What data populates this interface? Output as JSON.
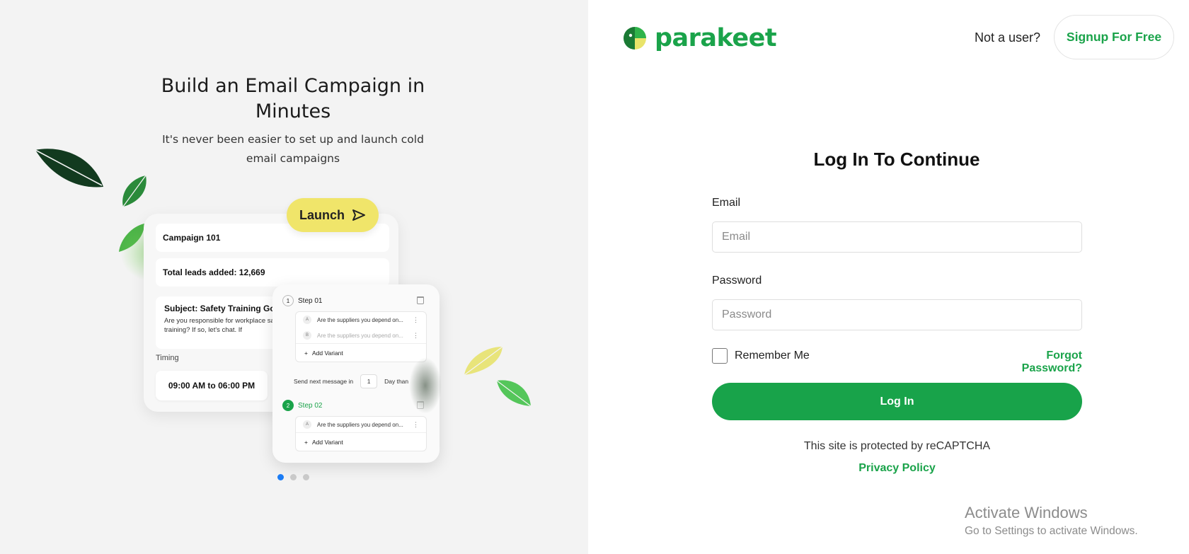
{
  "hero": {
    "title": "Build an Email Campaign in Minutes",
    "subtitle": "It's never been easier to set up and launch cold email campaigns",
    "launch_label": "Launch",
    "campaign_name": "Campaign 101",
    "leads": "Total leads added: 12,669",
    "subject": "Subject: Safety Training Go",
    "body": "Are you responsible for workplace safety training? If so, let's chat. If",
    "timing_label": "Timing",
    "timing_value": "09:00 AM to 06:00 PM",
    "step1_num": "1",
    "step1_label": "Step 01",
    "step2_num": "2",
    "step2_label": "Step 02",
    "variant_a_letter": "A",
    "variant_a_text": "Are the suppliers you depend on...",
    "variant_b_letter": "B",
    "variant_b_text": "Are the suppliers you depend on...",
    "variant_2a_letter": "A",
    "variant_2a_text": "Are the suppliers you depend on...",
    "add_variant": "Add Variant",
    "send_next": "Send next message in",
    "send_num": "1",
    "send_unit": "Day than",
    "slide_count": 3,
    "active_slide": 1
  },
  "header": {
    "brand": "parakeet",
    "not_user": "Not a user?",
    "signup": "Signup For Free"
  },
  "form": {
    "title": "Log In To Continue",
    "email_label": "Email",
    "email_placeholder": "Email",
    "password_label": "Password",
    "password_placeholder": "Password",
    "remember": "Remember Me",
    "forgot": "Forgot Password?",
    "login": "Log In",
    "recaptcha": "This site is protected by reCAPTCHA",
    "privacy": "Privacy Policy"
  },
  "watermark": {
    "line1": "Activate Windows",
    "line2": "Go to Settings to activate Windows."
  },
  "colors": {
    "brand_green": "#18a34a",
    "launch_yellow": "#f0e56a",
    "dark_leaf": "#123a1f",
    "active_dot": "#1b7cf5"
  }
}
